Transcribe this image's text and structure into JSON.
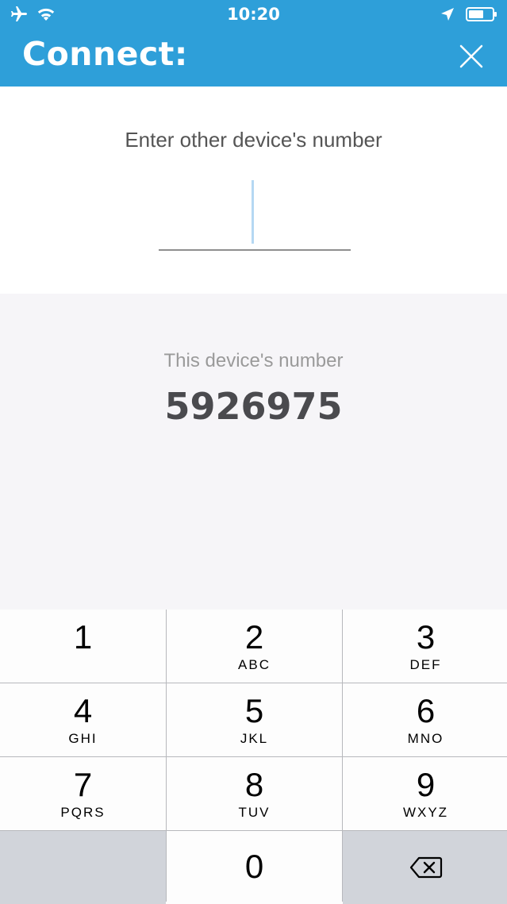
{
  "status_bar": {
    "time": "10:20",
    "icons": [
      "airplane-icon",
      "wifi-icon",
      "location-arrow-icon",
      "battery-icon"
    ]
  },
  "header": {
    "title": "Connect:",
    "close_icon": "close-icon",
    "background": "#2e9fd9"
  },
  "connect": {
    "prompt": "Enter other device's number",
    "input_value": ""
  },
  "device": {
    "label": "This device's number",
    "number": "5926975"
  },
  "keypad": {
    "keys": [
      {
        "digit": "1",
        "letters": ""
      },
      {
        "digit": "2",
        "letters": "ABC"
      },
      {
        "digit": "3",
        "letters": "DEF"
      },
      {
        "digit": "4",
        "letters": "GHI"
      },
      {
        "digit": "5",
        "letters": "JKL"
      },
      {
        "digit": "6",
        "letters": "MNO"
      },
      {
        "digit": "7",
        "letters": "PQRS"
      },
      {
        "digit": "8",
        "letters": "TUV"
      },
      {
        "digit": "9",
        "letters": "WXYZ"
      },
      {
        "digit": "0",
        "letters": ""
      }
    ],
    "backspace_icon": "backspace-icon"
  }
}
